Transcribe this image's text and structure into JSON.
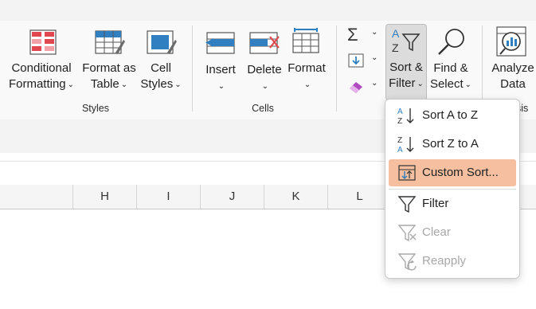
{
  "ribbon": {
    "styles_group": {
      "label": "Styles",
      "buttons": [
        {
          "line1": "Conditional",
          "line2": "Formatting",
          "icon": "conditional-formatting-icon"
        },
        {
          "line1": "Format as",
          "line2": "Table",
          "icon": "format-as-table-icon"
        },
        {
          "line1": "Cell",
          "line2": "Styles",
          "icon": "cell-styles-icon"
        }
      ]
    },
    "cells_group": {
      "label": "Cells",
      "buttons": [
        {
          "line1": "Insert",
          "icon": "insert-cells-icon"
        },
        {
          "line1": "Delete",
          "icon": "delete-cells-icon"
        },
        {
          "line1": "Format",
          "icon": "format-cells-icon"
        }
      ]
    },
    "editing_group": {
      "small_icons": [
        "autosum-icon",
        "fill-icon",
        "clear-eraser-icon"
      ],
      "sort_filter": {
        "line1": "Sort &",
        "line2": "Filter"
      },
      "find_select": {
        "line1": "Find &",
        "line2": "Select"
      }
    },
    "analysis_group": {
      "label_fragment": "sis",
      "analyze": {
        "line1": "Analyze",
        "line2": "Data"
      }
    }
  },
  "grid": {
    "columns": [
      "H",
      "I",
      "J",
      "K",
      "L"
    ]
  },
  "menu": {
    "items": [
      {
        "label": "Sort A to Z",
        "icon": "sort-a-to-z-icon",
        "state": "normal"
      },
      {
        "label": "Sort Z to A",
        "icon": "sort-z-to-a-icon",
        "state": "normal"
      },
      {
        "label": "Custom Sort...",
        "icon": "custom-sort-icon",
        "state": "highlighted"
      },
      {
        "label": "Filter",
        "icon": "filter-icon",
        "state": "normal"
      },
      {
        "label": "Clear",
        "icon": "clear-filter-icon",
        "state": "disabled"
      },
      {
        "label": "Reapply",
        "icon": "reapply-filter-icon",
        "state": "disabled"
      }
    ]
  },
  "colors": {
    "highlight": "#f5bfa0",
    "accent_blue": "#2f7fc1",
    "accent_red": "#e0464d",
    "disabled_text": "#a8a8a8"
  }
}
